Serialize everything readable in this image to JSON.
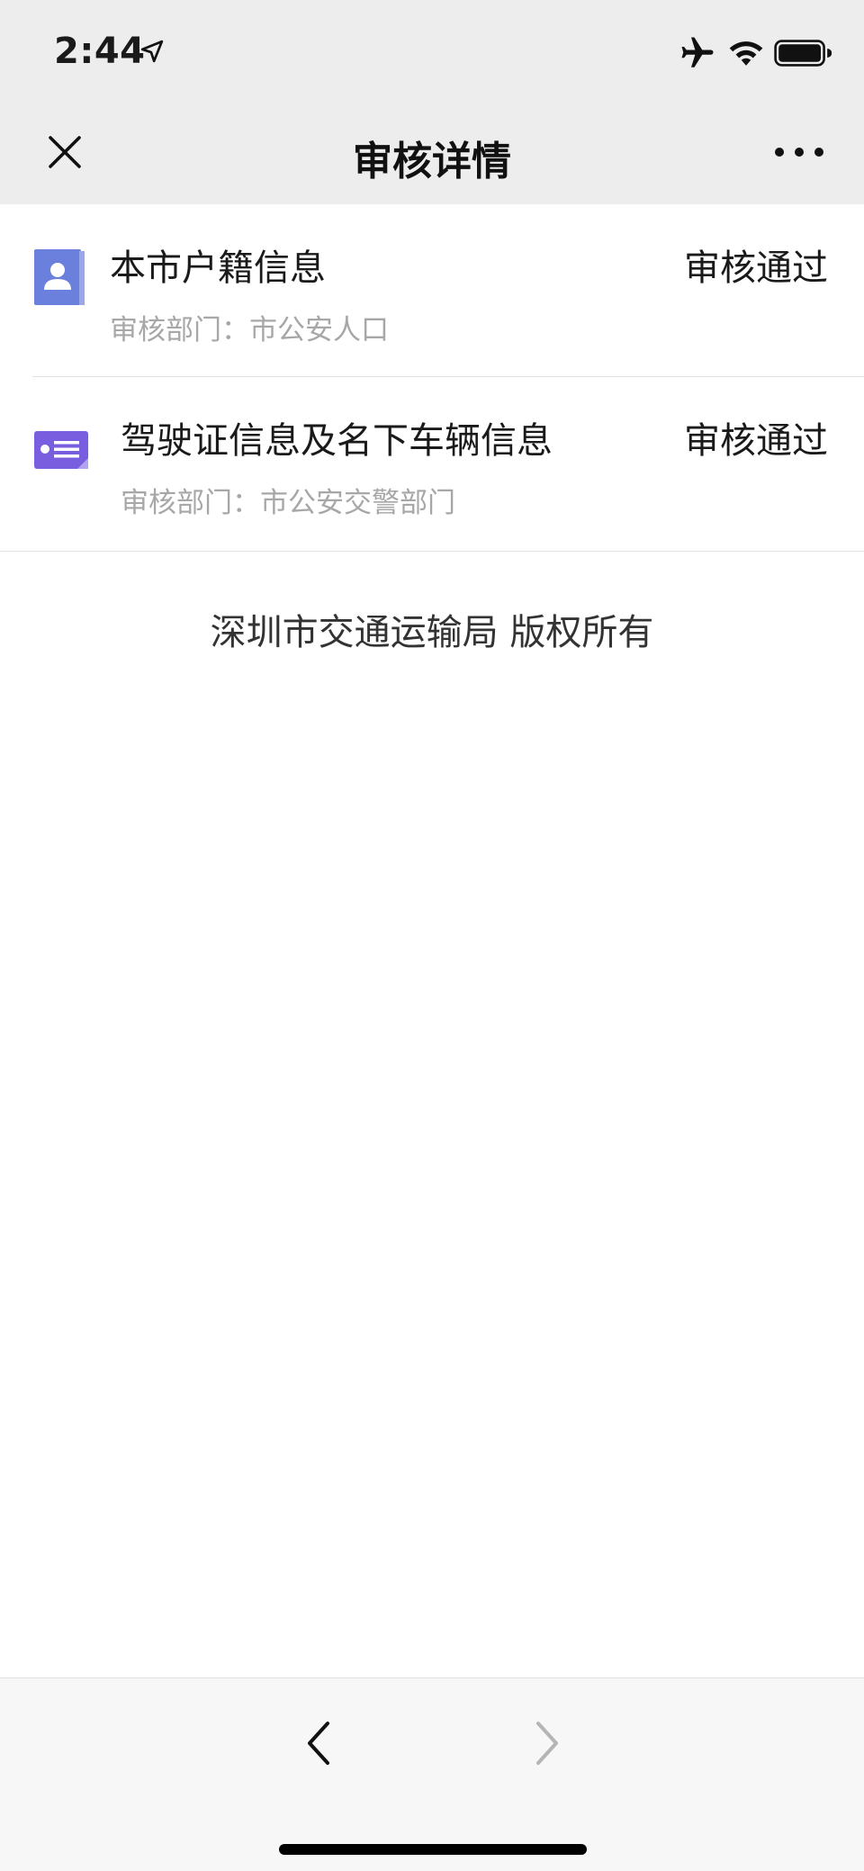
{
  "status_bar": {
    "time": "2:44",
    "icons": [
      "location-arrow-icon",
      "airplane-icon",
      "wifi-icon",
      "battery-icon"
    ]
  },
  "navbar": {
    "title": "审核详情",
    "close_icon": "close-icon",
    "more_icon": "more-icon"
  },
  "items": [
    {
      "title": "本市户籍信息",
      "department": "审核部门：市公安人口",
      "status": "审核通过",
      "icon": "person-card-icon",
      "icon_color": "#6b7fdc"
    },
    {
      "title": "驾驶证信息及名下车辆信息",
      "department": "审核部门：市公安交警部门",
      "status": "审核通过",
      "icon": "id-card-icon",
      "icon_color": "#7a5ee0"
    }
  ],
  "footer": {
    "copyright": "深圳市交通运输局 版权所有"
  },
  "bottom_nav": {
    "back_icon": "chevron-left-icon",
    "forward_icon": "chevron-right-icon",
    "forward_enabled": false
  }
}
